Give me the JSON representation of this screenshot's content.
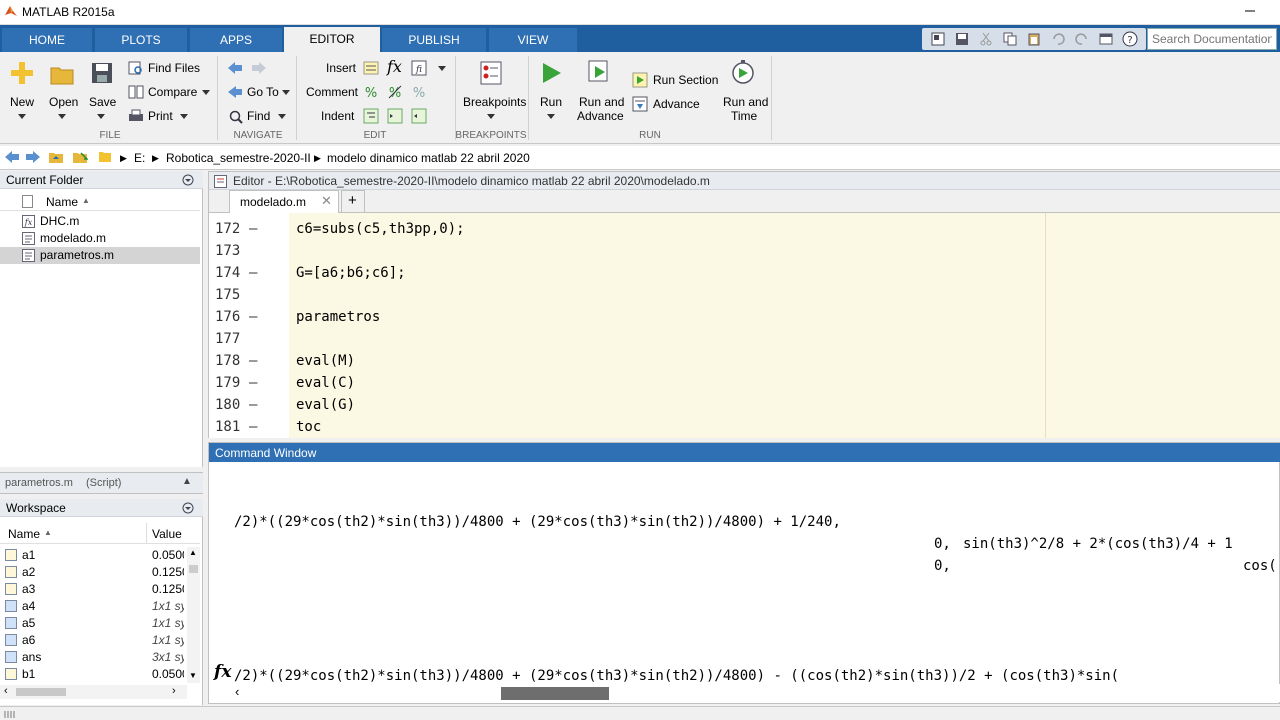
{
  "window": {
    "title": "MATLAB R2015a"
  },
  "ribbon_tabs": [
    {
      "label": "HOME"
    },
    {
      "label": "PLOTS"
    },
    {
      "label": "APPS"
    },
    {
      "label": "EDITOR"
    },
    {
      "label": "PUBLISH"
    },
    {
      "label": "VIEW"
    }
  ],
  "search": {
    "placeholder": "Search Documentation"
  },
  "ribbon": {
    "file": {
      "new": "New",
      "open": "Open",
      "save": "Save",
      "find_files": "Find Files",
      "compare": "Compare",
      "print": "Print",
      "section": "FILE"
    },
    "navigate": {
      "go_to": "Go To",
      "find": "Find",
      "section": "NAVIGATE"
    },
    "edit": {
      "insert": "Insert",
      "comment": "Comment",
      "indent": "Indent",
      "section": "EDIT"
    },
    "breakpoints": {
      "label": "Breakpoints",
      "section": "BREAKPOINTS"
    },
    "run": {
      "run": "Run",
      "run_and_advance_1": "Run and",
      "run_and_advance_2": "Advance",
      "run_section": "Run Section",
      "advance": "Advance",
      "run_and_time_1": "Run and",
      "run_and_time_2": "Time",
      "section": "RUN"
    }
  },
  "address": {
    "drive": "E:",
    "folder1": "Robotica_semestre-2020-II",
    "folder2": "modelo dinamico matlab 22 abril 2020"
  },
  "current_folder": {
    "title": "Current Folder",
    "name_col": "Name",
    "files": [
      {
        "name": "DHC.m"
      },
      {
        "name": "modelado.m"
      },
      {
        "name": "parametros.m"
      }
    ],
    "detail": "parametros.m",
    "detail_suffix": "(Script)"
  },
  "workspace": {
    "title": "Workspace",
    "name_col": "Name",
    "value_col": "Value",
    "vars": [
      {
        "name": "a1",
        "value": "0.0500"
      },
      {
        "name": "a2",
        "value": "0.1250"
      },
      {
        "name": "a3",
        "value": "0.1250"
      },
      {
        "name": "a4",
        "value": "1x1 sy"
      },
      {
        "name": "a5",
        "value": "1x1 sy"
      },
      {
        "name": "a6",
        "value": "1x1 sy"
      },
      {
        "name": "ans",
        "value": "3x1 sy"
      },
      {
        "name": "b1",
        "value": "0.0500"
      }
    ]
  },
  "editor": {
    "title": "Editor - E:\\Robotica_semestre-2020-II\\modelo dinamico matlab 22 abril 2020\\modelado.m",
    "tab": "modelado.m",
    "add_tab": "+",
    "lines": [
      {
        "num": "172",
        "dash": "—",
        "code": "c6=subs(c5,th3pp,0);"
      },
      {
        "num": "173",
        "dash": "",
        "code": ""
      },
      {
        "num": "174",
        "dash": "—",
        "code": "G=[a6;b6;c6];"
      },
      {
        "num": "175",
        "dash": "",
        "code": ""
      },
      {
        "num": "176",
        "dash": "—",
        "code": "parametros"
      },
      {
        "num": "177",
        "dash": "",
        "code": ""
      },
      {
        "num": "178",
        "dash": "—",
        "code": "eval(M)"
      },
      {
        "num": "179",
        "dash": "—",
        "code": "eval(C)"
      },
      {
        "num": "180",
        "dash": "—",
        "code": "eval(G)"
      },
      {
        "num": "181",
        "dash": "—",
        "code": "toc"
      }
    ]
  },
  "command_window": {
    "title": "Command Window",
    "line1": "/2)*((29*cos(th2)*sin(th3))/4800 + (29*cos(th3)*sin(th2))/4800) + 1/240,",
    "line2a": "0,",
    "line2b": "sin(th3)^2/8 + 2*(cos(th3)/4 + 1",
    "line3a": "0,",
    "line3b": "cos(",
    "prompt_symbol": "fx",
    "input": "/2)*((29*cos(th2)*sin(th3))/4800 + (29*cos(th3)*sin(th2))/4800) - ((cos(th2)*sin(th3))/2 + (cos(th3)*sin("
  }
}
